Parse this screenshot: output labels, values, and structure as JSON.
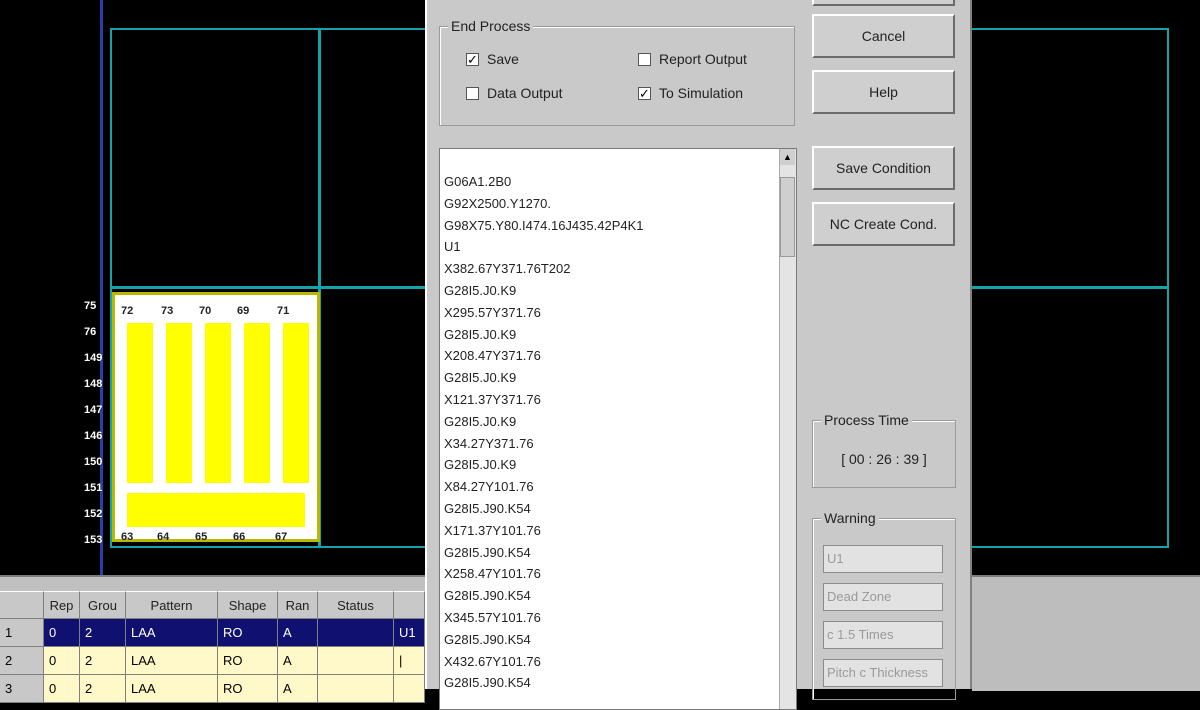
{
  "dialog": {
    "end_process": {
      "title": "End Process",
      "save": {
        "label": "Save",
        "checked": true
      },
      "report_output": {
        "label": "Report Output",
        "checked": false
      },
      "data_output": {
        "label": "Data Output",
        "checked": false
      },
      "to_simulation": {
        "label": "To Simulation",
        "checked": true
      }
    },
    "buttons": {
      "cancel": "Cancel",
      "help": "Help",
      "save_condition": "Save Condition",
      "nc_create_cond": "NC Create Cond."
    },
    "nc_code": [
      "G06A1.2B0",
      "G92X2500.Y1270.",
      "G98X75.Y80.I474.16J435.42P4K1",
      "U1",
      "X382.67Y371.76T202",
      "G28I5.J0.K9",
      "X295.57Y371.76",
      "G28I5.J0.K9",
      "X208.47Y371.76",
      "G28I5.J0.K9",
      "X121.37Y371.76",
      "G28I5.J0.K9",
      "X34.27Y371.76",
      "G28I5.J0.K9",
      "X84.27Y101.76",
      "G28I5.J90.K54",
      "X171.37Y101.76",
      "G28I5.J90.K54",
      "X258.47Y101.76",
      "G28I5.J90.K54",
      "X345.57Y101.76",
      "G28I5.J90.K54",
      "X432.67Y101.76",
      "G28I5.J90.K54"
    ],
    "process_time": {
      "title": "Process Time",
      "value": "[ 00 : 26 : 39 ]"
    },
    "warning": {
      "title": "Warning",
      "fields": [
        "U1",
        "Dead Zone",
        "c 1.5 Times",
        "Pitch c Thickness"
      ]
    }
  },
  "table": {
    "headers": [
      "",
      "Rep",
      "Grou",
      "Pattern",
      "Shape",
      "Ran",
      "Status",
      ""
    ],
    "rows": [
      [
        "1",
        "0",
        "2",
        "LAA",
        "RO",
        "A",
        "",
        "U1"
      ],
      [
        "2",
        "0",
        "2",
        "LAA",
        "RO",
        "A",
        "",
        "|"
      ],
      [
        "3",
        "0",
        "2",
        "LAA",
        "RO",
        "A",
        "",
        ""
      ]
    ]
  },
  "canvas": {
    "top_labels": [
      "72",
      "73",
      "70",
      "69",
      "71"
    ],
    "left_labels": [
      "75",
      "76",
      "149",
      "148",
      "147",
      "146",
      "150",
      "151",
      "152",
      "153"
    ],
    "bottom_labels": [
      "63",
      "64",
      "65",
      "66",
      "67"
    ]
  },
  "colors": {
    "background": "#000000",
    "guide_lines": "#13a3a8",
    "part_fill": "#ffff00",
    "dialog_bg": "#c9c9c9"
  }
}
